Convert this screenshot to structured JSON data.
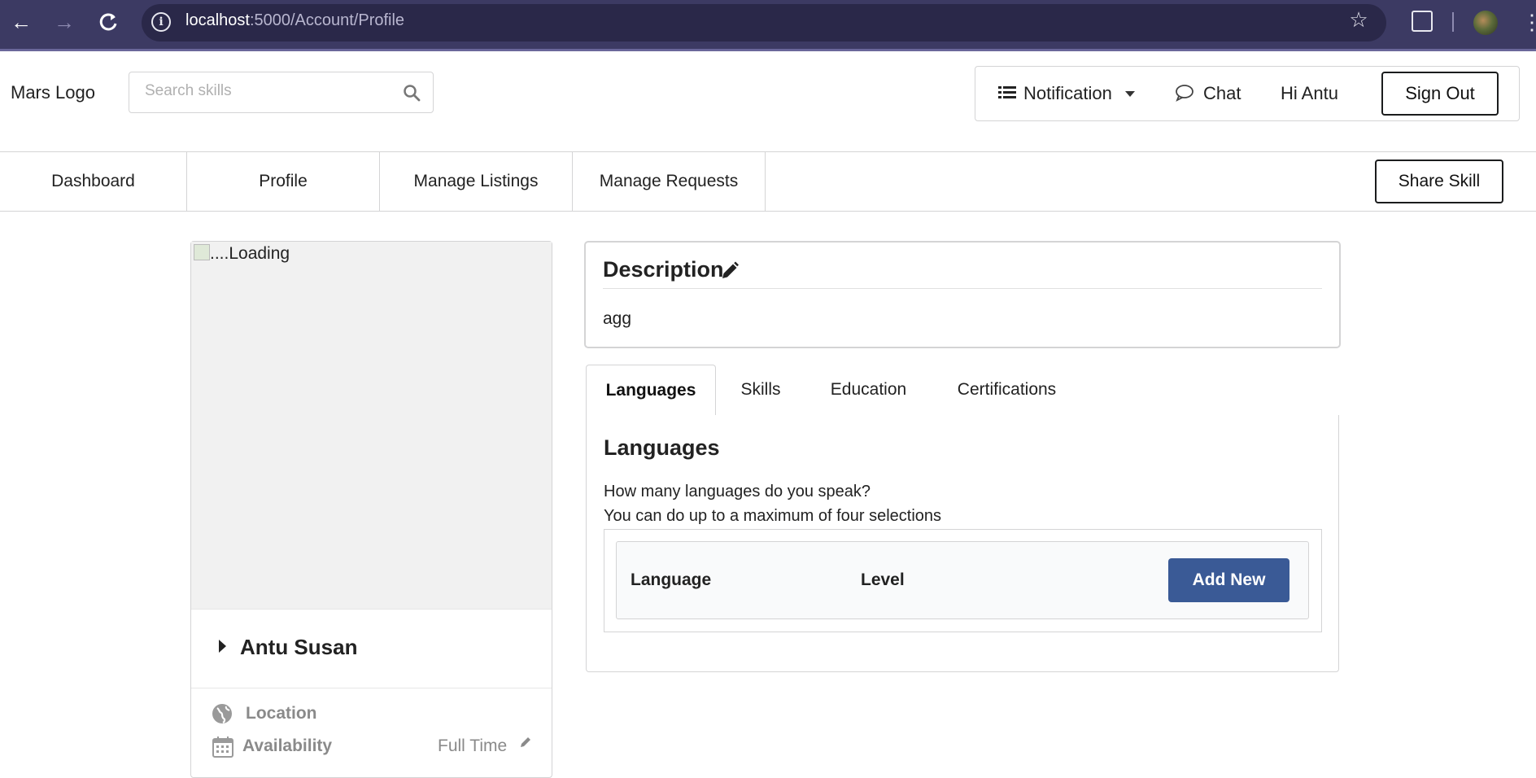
{
  "browser": {
    "url_host": "localhost",
    "url_path": ":5000/Account/Profile",
    "icons": [
      "back-arrow-icon",
      "forward-arrow-icon",
      "reload-icon",
      "info-icon",
      "star-icon",
      "extensions-icon",
      "profile-avatar-icon",
      "menu-kebab-icon"
    ]
  },
  "header": {
    "logo": "Mars Logo",
    "search_placeholder": "Search skills",
    "notification": "Notification",
    "chat": "Chat",
    "greeting": "Hi Antu",
    "sign_out": "Sign Out"
  },
  "subnav": {
    "items": [
      {
        "label": "Dashboard"
      },
      {
        "label": "Profile"
      },
      {
        "label": "Manage Listings"
      },
      {
        "label": "Manage Requests"
      }
    ],
    "share_skill": "Share Skill"
  },
  "profile_card": {
    "photo_alt": "....Loading",
    "name": "Antu Susan",
    "location_label": "Location",
    "availability_label": "Availability",
    "availability_value": "Full Time"
  },
  "description": {
    "title": "Description",
    "body": "agg"
  },
  "tabs": [
    {
      "label": "Languages",
      "active": true
    },
    {
      "label": "Skills",
      "active": false
    },
    {
      "label": "Education",
      "active": false
    },
    {
      "label": "Certifications",
      "active": false
    }
  ],
  "languages_panel": {
    "title": "Languages",
    "question": "How many languages do you speak?",
    "limit": "You can do up to a maximum of four selections",
    "columns": [
      "Language",
      "Level"
    ],
    "add_new": "Add New"
  },
  "colors": {
    "browser_bar": "#3c3a63",
    "primary_button": "#3a5a96"
  }
}
